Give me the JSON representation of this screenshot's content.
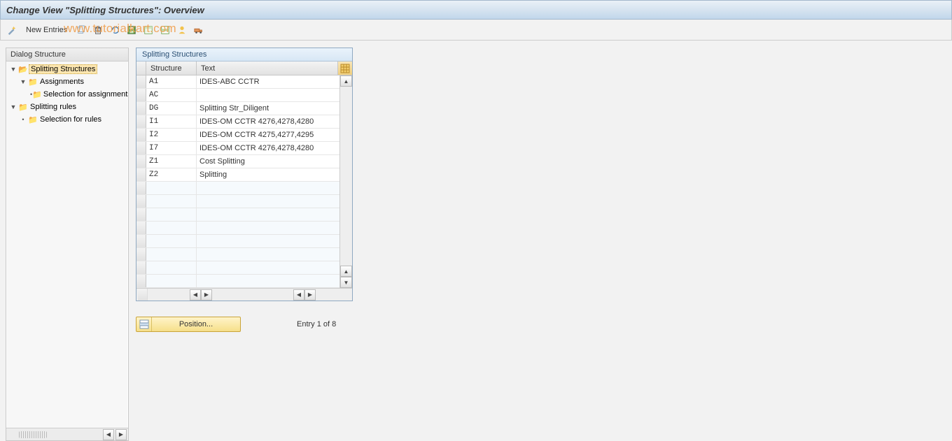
{
  "header": {
    "title": "Change View \"Splitting Structures\": Overview"
  },
  "watermark": "www.tutorialkart.com",
  "toolbar": {
    "new_entries": "New Entries",
    "icons": [
      "wand",
      "copy",
      "delete",
      "undo",
      "save",
      "select-all",
      "select-block",
      "worklist",
      "transport"
    ]
  },
  "dialog": {
    "title": "Dialog Structure",
    "tree": {
      "splitting_structures": "Splitting Structures",
      "assignments": "Assignments",
      "selection_for_assignments": "Selection for assignments",
      "splitting_rules": "Splitting rules",
      "selection_for_rules": "Selection for rules"
    }
  },
  "table": {
    "title": "Splitting Structures",
    "col_structure": "Structure",
    "col_text": "Text",
    "rows": [
      {
        "structure": "A1",
        "text": "IDES-ABC CCTR"
      },
      {
        "structure": "AC",
        "text": ""
      },
      {
        "structure": "DG",
        "text": "Splitting Str_Diligent"
      },
      {
        "structure": "I1",
        "text": "IDES-OM  CCTR 4276,4278,4280"
      },
      {
        "structure": "I2",
        "text": "IDES-OM  CCTR 4275,4277,4295"
      },
      {
        "structure": "I7",
        "text": "IDES-OM  CCTR 4276,4278,4280"
      },
      {
        "structure": "Z1",
        "text": "Cost Splitting"
      },
      {
        "structure": "Z2",
        "text": "Splitting"
      }
    ]
  },
  "footer": {
    "position_label": "Position...",
    "entry_text": "Entry 1 of 8"
  }
}
